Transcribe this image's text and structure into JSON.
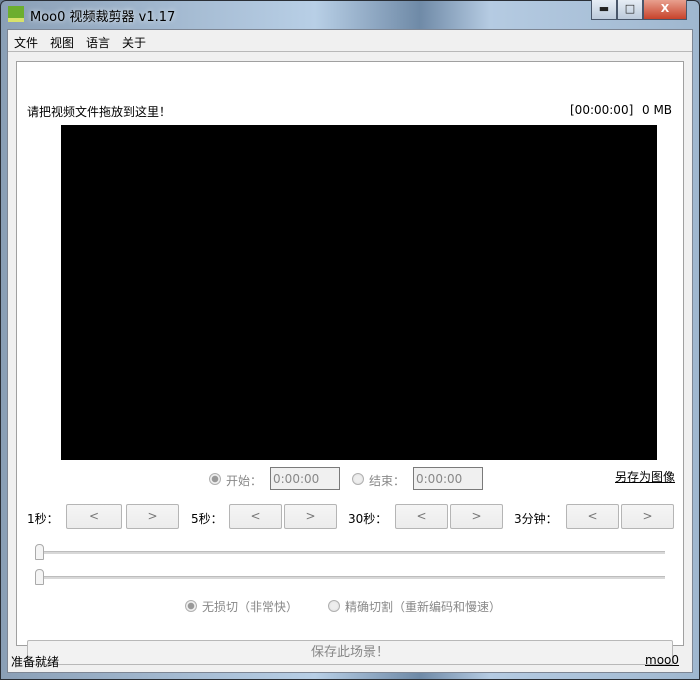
{
  "window": {
    "title": "Moo0 视频裁剪器 v1.17",
    "minimize": "▬",
    "maximize": "□",
    "close": "X"
  },
  "menu": [
    "文件",
    "视图",
    "语言",
    "关于"
  ],
  "header": {
    "drop_hint": "请把视频文件拖放到这里！",
    "time": "[00:00:00]",
    "size": "0 MB"
  },
  "range": {
    "start_label": "开始：",
    "start_value": "0:00:00",
    "end_label": "结束：",
    "end_value": "0:00:00",
    "save_image": "另存为图像"
  },
  "steps": [
    {
      "label": "1秒：",
      "prev": "<",
      "next": ">"
    },
    {
      "label": "5秒：",
      "prev": "<",
      "next": ">"
    },
    {
      "label": "30秒：",
      "prev": "<",
      "next": ">"
    },
    {
      "label": "3分钟：",
      "prev": "<",
      "next": ">"
    }
  ],
  "sliders": {
    "start_position": 0,
    "end_position": 0
  },
  "mode": {
    "lossless": "无损切（非常快）",
    "precise": "精确切割（重新编码和慢速）",
    "selected": "lossless"
  },
  "save_button": "保存此场景！",
  "status": {
    "text": "准备就绪",
    "link": "moo0"
  }
}
